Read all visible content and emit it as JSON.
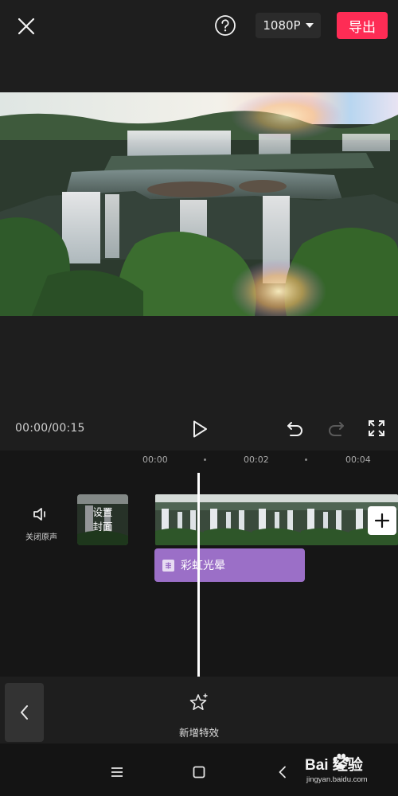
{
  "header": {
    "resolution": "1080P",
    "export_label": "导出",
    "accent_color": "#fe2c55"
  },
  "player": {
    "time_code": "00:00/00:15"
  },
  "timeline": {
    "ruler_labels": [
      "00:00",
      "00:02",
      "00:04"
    ],
    "mute_label": "关闭原声",
    "cover_label_line1": "设置",
    "cover_label_line2": "封面",
    "effect_clip": {
      "name": "彩虹光晕",
      "color": "#9b6fc7"
    }
  },
  "toolbar": {
    "add_effect_label": "新增特效"
  },
  "watermark": {
    "brand": "Bai 经验",
    "site": "jingyan.baidu.com"
  },
  "icons": {
    "close": "close-icon",
    "help": "help-icon",
    "play": "play-icon",
    "undo": "undo-icon",
    "redo": "redo-icon",
    "fullscreen": "fullscreen-icon",
    "speaker": "speaker-icon",
    "add": "plus-icon",
    "back": "chevron-left-icon",
    "effect": "star-sparkle-icon",
    "menu": "menu-icon",
    "home": "home-icon",
    "nav_back": "nav-back-icon",
    "paw": "paw-icon"
  }
}
